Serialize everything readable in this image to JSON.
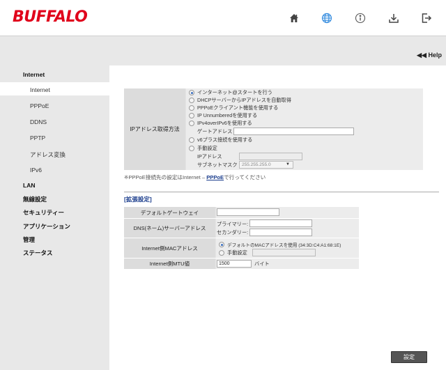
{
  "brand": {
    "logo": "BUFFALO",
    "color": "#e0001b",
    "accent": "#3a8fe0"
  },
  "top_nav": [
    {
      "name": "home-icon",
      "active": false
    },
    {
      "name": "globe-icon",
      "active": true
    },
    {
      "name": "info-icon",
      "active": false
    },
    {
      "name": "download-icon",
      "active": false
    },
    {
      "name": "logout-icon",
      "active": false
    }
  ],
  "help": {
    "label": "◀◀ Help"
  },
  "sidebar": {
    "internet": "Internet",
    "items": [
      {
        "label": "Internet",
        "active": true
      },
      {
        "label": "PPPoE"
      },
      {
        "label": "DDNS"
      },
      {
        "label": "PPTP"
      },
      {
        "label": "アドレス変換"
      },
      {
        "label": "IPv6"
      }
    ],
    "lan": "LAN",
    "wireless": "無線設定",
    "security": "セキュリティー",
    "application": "アプリケーション",
    "admin": "管理",
    "status": "ステータス"
  },
  "ip_method": {
    "label": "IPアドレス取得方法",
    "opt1": "インターネット@スタートを行う",
    "opt2": "DHCPサーバーからIPアドレスを自動取得",
    "opt3": "PPPoEクライアント機能を使用する",
    "opt4": "IP Unnumberedを使用する",
    "opt5": "IPv4overIPv6を使用する",
    "gateway_label": "ゲートアドレス",
    "gateway_value": "",
    "opt6": "v6プラス接続を使用する",
    "opt7": "手動設定",
    "ip_label": "IPアドレス",
    "ip_value": "",
    "subnet_label": "サブネットマスク",
    "subnet_value": "255.255.255.0",
    "selected": 0
  },
  "note": {
    "prefix": "※PPPoE接続先の設定はInternet – ",
    "link": "PPPoE",
    "suffix": "で行ってください"
  },
  "extended": {
    "title": "[拡張設定]",
    "default_gw_label": "デフォルトゲートウェイ",
    "default_gw_value": "",
    "dns_label": "DNS(ネーム)サーバーアドレス",
    "dns_primary_label": "プライマリー:",
    "dns_primary_value": "",
    "dns_secondary_label": "セカンダリー:",
    "dns_secondary_value": "",
    "mac_label": "Internet側MACアドレス",
    "mac_default": "デフォルトのMACアドレスを使用 (34:3D:C4:A1:68:1E)",
    "mac_manual": "手動設定",
    "mac_manual_value": "",
    "mtu_label": "Internet側MTU値",
    "mtu_value": "1500",
    "mtu_unit": "バイト"
  },
  "submit_label": "設定"
}
